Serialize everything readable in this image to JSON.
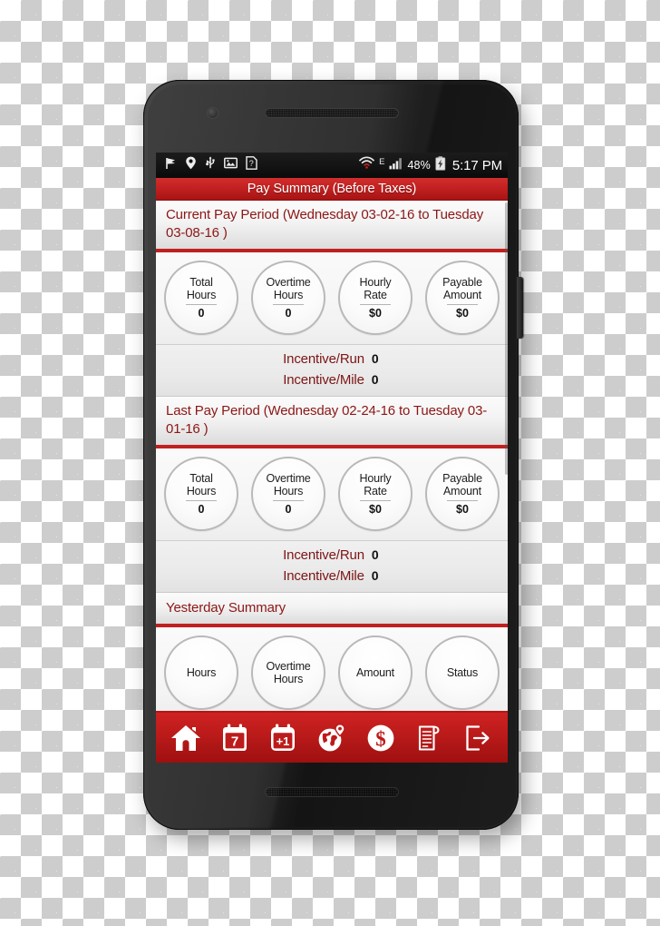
{
  "status_bar": {
    "icons_left": [
      "flag-icon",
      "location-pin-icon",
      "usb-icon",
      "picture-icon",
      "sim-help-icon"
    ],
    "wifi": "wifi-icon",
    "network_type": "E",
    "signal": "signal-bars-icon",
    "battery_percent": "48%",
    "battery": "battery-charging-icon",
    "clock": "5:17 PM"
  },
  "title_bar": {
    "title": "Pay Summary (Before Taxes)"
  },
  "colors": {
    "brand_red": "#c02020",
    "header_red_text": "#8c1616",
    "nav_red": "#bd1b1b",
    "screen_bg": "#f0f0f0"
  },
  "sections": [
    {
      "id": "current-pay-period",
      "header": "Current Pay Period (Wednesday 03-02-16 to Tuesday 03-08-16 )",
      "metrics": [
        {
          "label_line1": "Total",
          "label_line2": "Hours",
          "value": "0"
        },
        {
          "label_line1": "Overtime",
          "label_line2": "Hours",
          "value": "0"
        },
        {
          "label_line1": "Hourly",
          "label_line2": "Rate",
          "value": "$0"
        },
        {
          "label_line1": "Payable",
          "label_line2": "Amount",
          "value": "$0"
        }
      ],
      "incentives": [
        {
          "label": "Incentive/Run",
          "value": "0"
        },
        {
          "label": "Incentive/Mile",
          "value": "0"
        }
      ]
    },
    {
      "id": "last-pay-period",
      "header": "Last Pay Period (Wednesday 02-24-16 to Tuesday 03-01-16 )",
      "metrics": [
        {
          "label_line1": "Total",
          "label_line2": "Hours",
          "value": "0"
        },
        {
          "label_line1": "Overtime",
          "label_line2": "Hours",
          "value": "0"
        },
        {
          "label_line1": "Hourly",
          "label_line2": "Rate",
          "value": "$0"
        },
        {
          "label_line1": "Payable",
          "label_line2": "Amount",
          "value": "$0"
        }
      ],
      "incentives": [
        {
          "label": "Incentive/Run",
          "value": "0"
        },
        {
          "label": "Incentive/Mile",
          "value": "0"
        }
      ]
    },
    {
      "id": "yesterday-summary",
      "header": "Yesterday Summary",
      "metrics": [
        {
          "label_line1": "Hours",
          "label_line2": "",
          "value": ""
        },
        {
          "label_line1": "Overtime",
          "label_line2": "Hours",
          "value": ""
        },
        {
          "label_line1": "Amount",
          "label_line2": "",
          "value": ""
        },
        {
          "label_line1": "Status",
          "label_line2": "",
          "value": ""
        }
      ]
    }
  ],
  "nav_bar": {
    "items": [
      {
        "icon": "home-icon",
        "label": "Home"
      },
      {
        "icon": "calendar-7-icon",
        "label": "Calendar",
        "badge": "7"
      },
      {
        "icon": "calendar-plus-one-icon",
        "label": "Add Day",
        "badge": "+1"
      },
      {
        "icon": "globe-pin-icon",
        "label": "Map"
      },
      {
        "icon": "dollar-circle-icon",
        "label": "Pay"
      },
      {
        "icon": "document-scroll-icon",
        "label": "Reports"
      },
      {
        "icon": "logout-icon",
        "label": "Logout"
      }
    ]
  }
}
